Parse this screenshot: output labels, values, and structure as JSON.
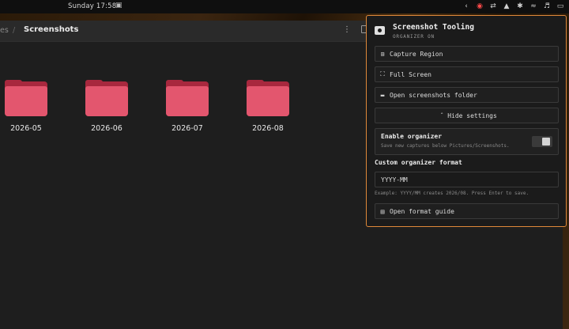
{
  "topbar": {
    "clock": "Sunday 17:58",
    "tray_icons": [
      "chevron-left-icon",
      "screenshot-icon",
      "network-off-icon",
      "drive-icon",
      "bluetooth-icon",
      "wifi-icon",
      "volume-icon",
      "display-icon"
    ]
  },
  "file_manager": {
    "breadcrumb_prev": "es",
    "breadcrumb_sep": "/",
    "breadcrumb_current": "Screenshots",
    "folders": [
      {
        "name": "2026-05"
      },
      {
        "name": "2026-06"
      },
      {
        "name": "2026-07"
      },
      {
        "name": "2026-08"
      }
    ],
    "folder_color": "#e3566e"
  },
  "popup": {
    "title": "Screenshot Tooling",
    "subtitle": "ORGANIZER ON",
    "capture_region": "Capture Region",
    "full_screen": "Full Screen",
    "open_folder": "Open screenshots folder",
    "hide_settings": "Hide settings",
    "organizer_title": "Enable organizer",
    "organizer_desc": "Save new captures below Pictures/Screenshots.",
    "organizer_enabled": true,
    "format_label": "Custom organizer format",
    "format_value": "YYYY-MM",
    "format_hint": "Example: YYYY/MM creates 2026/08. Press Enter to save.",
    "format_guide": "Open format guide",
    "accent": "#e0893a"
  }
}
